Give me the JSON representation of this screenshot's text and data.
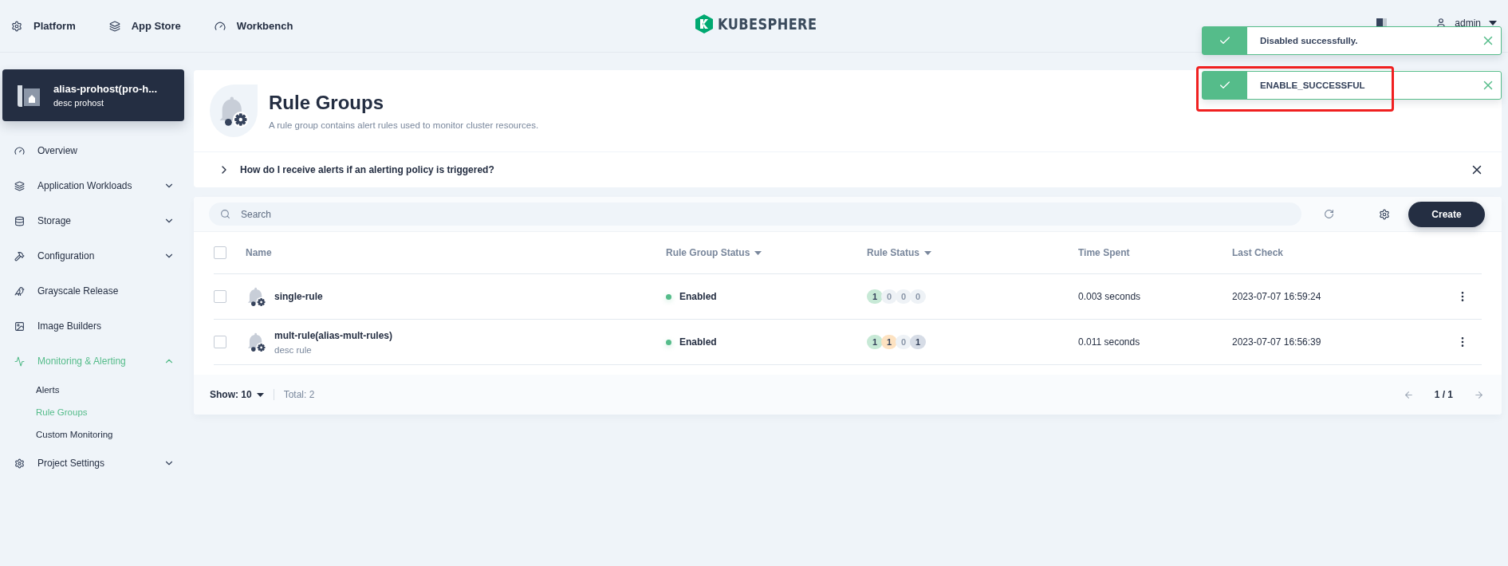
{
  "top_nav": [
    {
      "label": "Platform"
    },
    {
      "label": "App Store"
    },
    {
      "label": "Workbench"
    }
  ],
  "logo": "KUBESPHERE",
  "user": {
    "name": "admin"
  },
  "project": {
    "name": "alias-prohost(pro-h...",
    "description": "desc prohost"
  },
  "sidebar": {
    "items": [
      {
        "label": "Overview",
        "selected": false
      },
      {
        "label": "Application Workloads",
        "selected": false,
        "expanded": false
      },
      {
        "label": "Storage",
        "selected": false,
        "expanded": false
      },
      {
        "label": "Configuration",
        "selected": false,
        "expanded": false
      },
      {
        "label": "Grayscale Release",
        "selected": false
      },
      {
        "label": "Image Builders",
        "selected": false
      },
      {
        "label": "Monitoring & Alerting",
        "selected": true,
        "expanded": true,
        "children": [
          {
            "label": "Alerts",
            "selected": false
          },
          {
            "label": "Rule Groups",
            "selected": true
          },
          {
            "label": "Custom Monitoring",
            "selected": false
          }
        ]
      },
      {
        "label": "Project Settings",
        "selected": false,
        "expanded": false
      }
    ]
  },
  "header": {
    "title": "Rule Groups",
    "description": "A rule group contains alert rules used to monitor cluster resources."
  },
  "help": {
    "question": "How do I receive alerts if an alerting policy is triggered?",
    "expanded": false
  },
  "toolbar": {
    "search": {
      "placeholder": "Search"
    },
    "create": "Create"
  },
  "table": {
    "all_selected": false,
    "columns": [
      {
        "label": "Name",
        "sortable": false
      },
      {
        "label": "Rule Group Status",
        "sortable": true
      },
      {
        "label": "Rule Status",
        "sortable": true
      },
      {
        "label": "Time Spent",
        "sortable": false
      },
      {
        "label": "Last Check",
        "sortable": false
      }
    ],
    "rows": [
      {
        "selected": false,
        "name": "single-rule",
        "status": {
          "label": "Enabled",
          "color": "#55bc8a"
        },
        "rule_counts": [
          {
            "count": "1",
            "color": "#c7e9d6",
            "active": true
          },
          {
            "count": "0",
            "color": "#eef2f6",
            "active": false
          },
          {
            "count": "0",
            "color": "#eef2f6",
            "active": false
          },
          {
            "count": "0",
            "color": "#eef2f6",
            "active": false
          }
        ],
        "time_spent": "0.003 seconds",
        "last_check": "2023-07-07 16:59:24"
      },
      {
        "selected": false,
        "name": "mult-rule(alias-mult-rules)",
        "description": "desc rule",
        "status": {
          "label": "Enabled",
          "color": "#55bc8a"
        },
        "rule_counts": [
          {
            "count": "1",
            "color": "#c7e9d6",
            "active": true
          },
          {
            "count": "1",
            "color": "#fde2c1",
            "active": true
          },
          {
            "count": "0",
            "color": "#eef2f6",
            "active": false
          },
          {
            "count": "1",
            "color": "#d6dce6",
            "active": true
          }
        ],
        "time_spent": "0.011 seconds",
        "last_check": "2023-07-07 16:56:39"
      }
    ]
  },
  "footer": {
    "page_size": "Show: 10",
    "total": "Total: 2",
    "page": "1 / 1"
  },
  "toasts": [
    {
      "message": "Disabled successfully.",
      "highlighted": false
    },
    {
      "message": "ENABLE_SUCCESSFUL",
      "highlighted": true
    }
  ]
}
